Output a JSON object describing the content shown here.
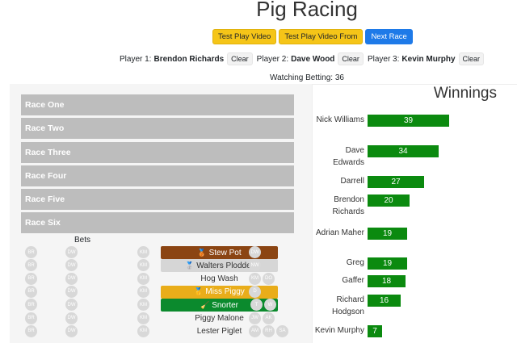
{
  "title": "Pig Racing",
  "buttons": {
    "test_play_video": "Test Play Video",
    "test_play_video_from": "Test Play Video From",
    "next_race": "Next Race"
  },
  "players": [
    {
      "label": "Player 1:",
      "name": "Brendon Richards",
      "clear": "Clear"
    },
    {
      "label": "Player 2:",
      "name": "Dave Wood",
      "clear": "Clear"
    },
    {
      "label": "Player 3:",
      "name": "Kevin Murphy",
      "clear": "Clear"
    }
  ],
  "watching": "Watching Betting: 36",
  "races": [
    "Race One",
    "Race Two",
    "Race Three",
    "Race Four",
    "Race Five",
    "Race Six"
  ],
  "bets_heading": "Bets",
  "bet_chips": [
    "BR",
    "DW",
    "KM"
  ],
  "pigs": [
    {
      "name": "Stew Pot",
      "style": "brown",
      "icon": "medal-icon",
      "glyph": "🥉",
      "chips": [
        "DW"
      ]
    },
    {
      "name": "Walters Plodder",
      "style": "silver",
      "icon": "medal-icon",
      "glyph": "🥈",
      "chips": [
        "NW"
      ]
    },
    {
      "name": "Hog Wash",
      "style": "plain",
      "icon": "",
      "glyph": "",
      "chips": [
        "KM",
        "DO"
      ]
    },
    {
      "name": "Miss Piggy",
      "style": "gold",
      "icon": "medal-icon",
      "glyph": "🥇",
      "chips": [
        "D"
      ]
    },
    {
      "name": "Snorter",
      "style": "green",
      "icon": "broom-icon",
      "glyph": "🧹",
      "chips": [
        "T",
        "W"
      ]
    },
    {
      "name": "Piggy Malone",
      "style": "plain",
      "icon": "",
      "glyph": "",
      "chips": [
        "JW",
        "AK"
      ]
    },
    {
      "name": "Lester Piglet",
      "style": "plain",
      "icon": "",
      "glyph": "",
      "chips": [
        "AM",
        "RH",
        "SA"
      ]
    }
  ],
  "winnings_heading": "Winnings",
  "winnings": [
    {
      "name": "Nick Williams",
      "value": 39
    },
    {
      "name": "Dave Edwards",
      "value": 34
    },
    {
      "name": "Darrell",
      "value": 27
    },
    {
      "name": "Brendon Richards",
      "value": 20
    },
    {
      "name": "Adrian Maher",
      "value": 19
    },
    {
      "name": "Greg",
      "value": 19
    },
    {
      "name": "Gaffer",
      "value": 18
    },
    {
      "name": "Richard Hodgson",
      "value": 16
    },
    {
      "name": "Kevin Murphy",
      "value": 7
    }
  ],
  "colors": {
    "bar": "#0b8a0f",
    "race_bg": "#bdbdbd",
    "warn": "#f5c518",
    "primary": "#1e7ae8"
  }
}
